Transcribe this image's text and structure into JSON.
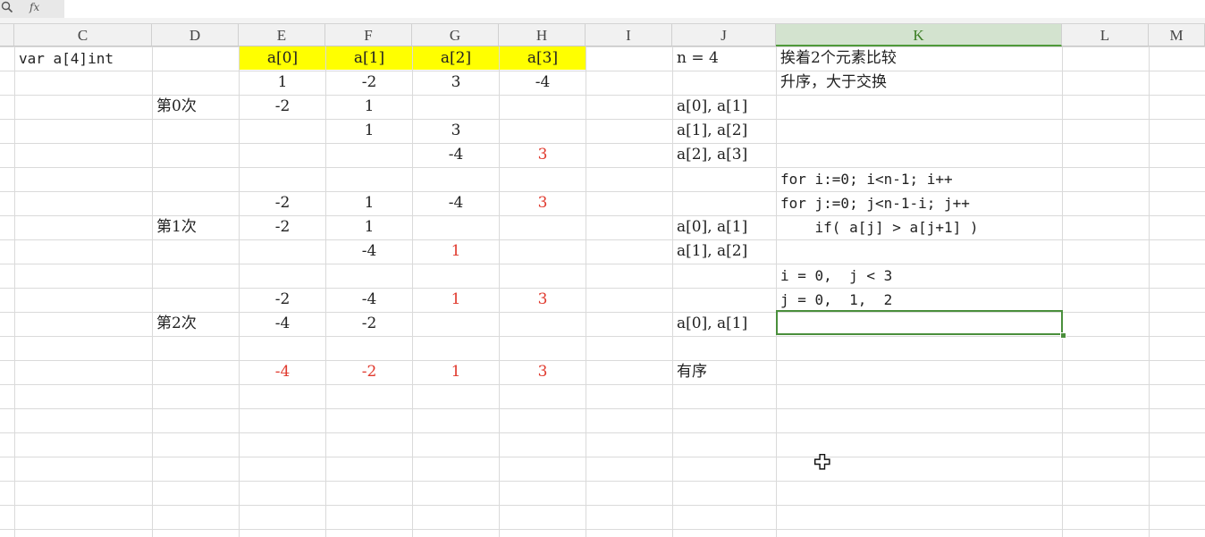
{
  "formula_bar": {
    "fx_label": "fx",
    "search_icon": "magnifier-icon"
  },
  "columns": [
    "C",
    "D",
    "E",
    "F",
    "G",
    "H",
    "I",
    "J",
    "K",
    "L",
    "M"
  ],
  "selected_column": "K",
  "cells": {
    "C1": "var a[4]int",
    "E1": "a[0]",
    "F1": "a[1]",
    "G1": "a[2]",
    "H1": "a[3]",
    "J1": "n = 4",
    "K1": "挨着2个元素比较",
    "E2": "1",
    "F2": "-2",
    "G2": "3",
    "H2": "-4",
    "K2": "升序，大于交换",
    "D3": "第0次",
    "E3": "-2",
    "F3": "1",
    "J3": "a[0], a[1]",
    "F4": "1",
    "G4": "3",
    "J4": "a[1], a[2]",
    "G5": "-4",
    "H5": "3",
    "J5": "a[2], a[3]",
    "K6": "for i:=0; i<n-1; i++",
    "E7": "-2",
    "F7": "1",
    "G7": "-4",
    "H7": "3",
    "K7": "for j:=0; j<n-1-i; j++",
    "D8": "第1次",
    "E8": "-2",
    "F8": "1",
    "J8": "a[0], a[1]",
    "K8": "    if( a[j] > a[j+1] )",
    "F9": "-4",
    "G9": "1",
    "J9": "a[1], a[2]",
    "K10": "i = 0,  j < 3",
    "E11": "-2",
    "F11": "-4",
    "G11": "1",
    "H11": "3",
    "K11": "j = 0,  1,  2",
    "D12": "第2次",
    "E12": "-4",
    "F12": "-2",
    "J12": "a[0], a[1]",
    "E14": "-4",
    "F14": "-2",
    "G14": "1",
    "H14": "3",
    "J14": "有序"
  },
  "colors": {
    "highlight_yellow": "#ffff00",
    "swap_red": "#e03a2e",
    "selection_green": "#4a8f3c"
  }
}
